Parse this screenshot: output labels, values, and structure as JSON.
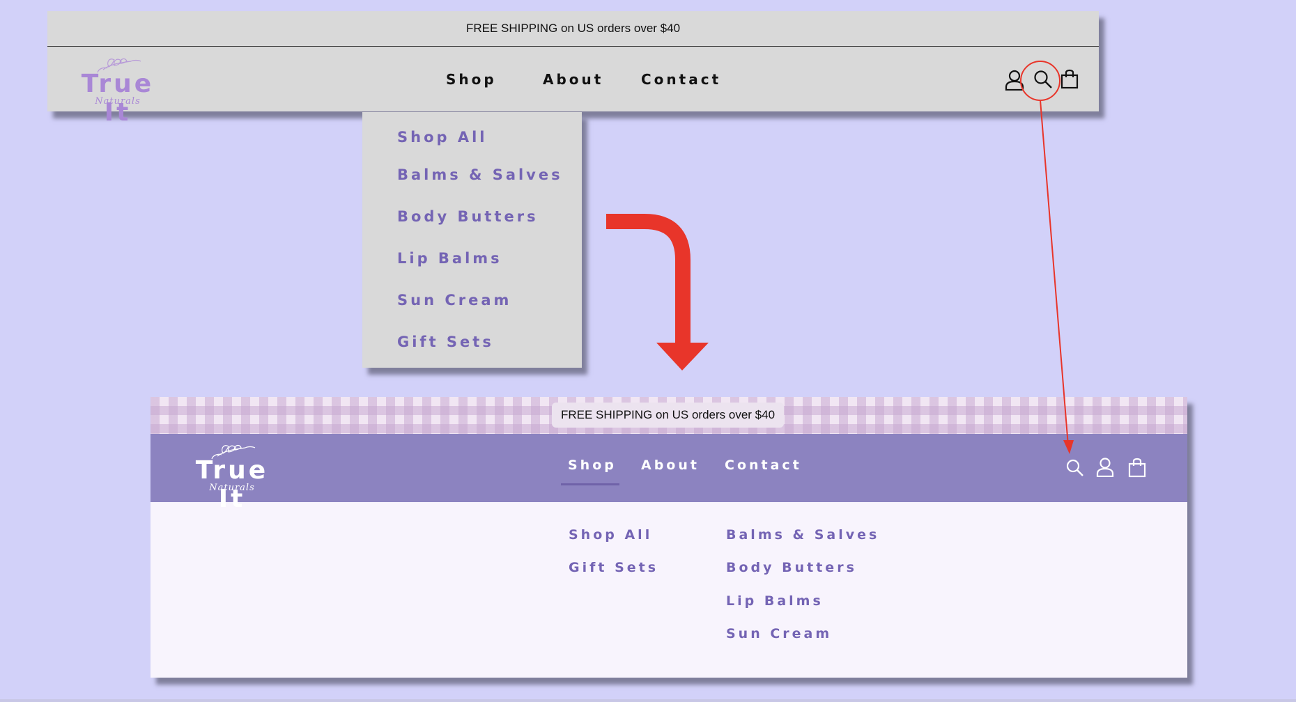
{
  "old_header": {
    "announcement": "FREE SHIPPING on US orders over $40",
    "logo": {
      "word": "True It",
      "sub": "Naturals"
    },
    "nav": {
      "shop": "Shop",
      "about": "About",
      "contact": "Contact"
    },
    "icons": [
      "account-icon",
      "search-icon",
      "shopping-bag-icon"
    ],
    "dropdown": [
      "Shop All",
      "Balms & Salves",
      "Body Butters",
      "Lip Balms",
      "Sun Cream",
      "Gift Sets"
    ]
  },
  "new_header": {
    "announcement": "FREE SHIPPING on US orders over $40",
    "logo": {
      "word": "True It",
      "sub": "Naturals"
    },
    "nav": {
      "shop": "Shop",
      "about": "About",
      "contact": "Contact"
    },
    "icons": [
      "search-icon",
      "account-icon",
      "shopping-bag-icon"
    ],
    "mega_menu": {
      "column_1": [
        "Shop All",
        "Gift Sets"
      ],
      "column_2": [
        "Balms & Salves",
        "Body Butters",
        "Lip Balms",
        "Sun Cream"
      ]
    }
  },
  "colors": {
    "background": "#d2d1f9",
    "old_header_bg": "#d9d9d9",
    "new_nav_bg": "#8c83c0",
    "menu_text": "#7464b4",
    "annotation_red": "#e8352a",
    "new_menu_bg": "#f8f4fd"
  }
}
